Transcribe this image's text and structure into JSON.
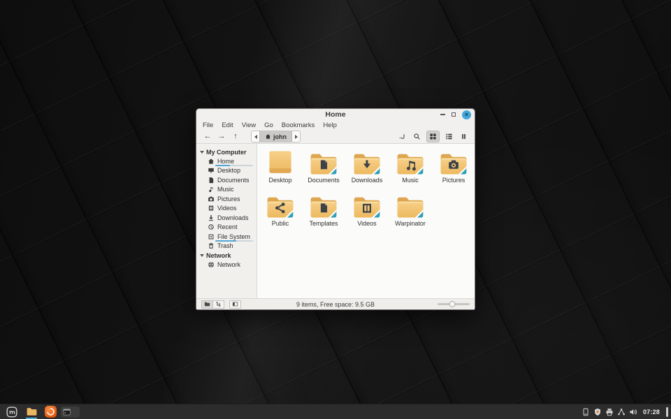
{
  "colors": {
    "accent": "#4da6d6",
    "close_button": "#45a7d9",
    "folder": "#f3c776",
    "folder_tab": "#dda64f",
    "emblem": "#3d4247",
    "ribbon": "#2f9fb7",
    "taskbar": "#2c2c2c"
  },
  "window": {
    "title": "Home",
    "controls": {
      "close": "×"
    },
    "menubar": {
      "items": [
        {
          "label": "File"
        },
        {
          "label": "Edit"
        },
        {
          "label": "View"
        },
        {
          "label": "Go"
        },
        {
          "label": "Bookmarks"
        },
        {
          "label": "Help"
        }
      ]
    },
    "toolbar": {
      "path_segment": "john",
      "nav": {
        "back": "←",
        "forward": "→",
        "up": "↑"
      }
    },
    "sidebar": {
      "sections": [
        {
          "label": "My Computer",
          "items": [
            {
              "label": "Home",
              "icon": "home",
              "selected": true,
              "usage": 0.38,
              "name": "sidebar-item-home"
            },
            {
              "label": "Desktop",
              "icon": "desktop",
              "name": "sidebar-item-desktop"
            },
            {
              "label": "Documents",
              "icon": "document",
              "name": "sidebar-item-documents"
            },
            {
              "label": "Music",
              "icon": "music",
              "name": "sidebar-item-music"
            },
            {
              "label": "Pictures",
              "icon": "camera",
              "name": "sidebar-item-pictures"
            },
            {
              "label": "Videos",
              "icon": "video",
              "name": "sidebar-item-videos"
            },
            {
              "label": "Downloads",
              "icon": "download",
              "name": "sidebar-item-downloads"
            },
            {
              "label": "Recent",
              "icon": "recent",
              "name": "sidebar-item-recent"
            },
            {
              "label": "File System",
              "icon": "filesystem",
              "usage": 0.55,
              "name": "sidebar-item-filesystem"
            },
            {
              "label": "Trash",
              "icon": "trash",
              "name": "sidebar-item-trash"
            }
          ]
        },
        {
          "label": "Network",
          "items": [
            {
              "label": "Network",
              "icon": "network",
              "name": "sidebar-item-network"
            }
          ]
        }
      ]
    },
    "files": [
      {
        "name": "Desktop",
        "icon": "desktop",
        "emblem": "none"
      },
      {
        "name": "Documents",
        "icon": "folder",
        "emblem": "document"
      },
      {
        "name": "Downloads",
        "icon": "folder",
        "emblem": "download"
      },
      {
        "name": "Music",
        "icon": "folder",
        "emblem": "music"
      },
      {
        "name": "Pictures",
        "icon": "folder",
        "emblem": "camera"
      },
      {
        "name": "Public",
        "icon": "folder",
        "emblem": "share"
      },
      {
        "name": "Templates",
        "icon": "folder",
        "emblem": "document"
      },
      {
        "name": "Videos",
        "icon": "folder",
        "emblem": "video"
      },
      {
        "name": "Warpinator",
        "icon": "folder",
        "emblem": "none"
      }
    ],
    "statusbar": {
      "text": "9 items, Free space: 9.5 GB",
      "zoom_level": 0.45
    }
  },
  "taskbar": {
    "clock": "07:28",
    "tray": [
      {
        "icon": "report",
        "name": "report-tray-icon"
      },
      {
        "icon": "shield",
        "name": "update-shield-tray-icon"
      },
      {
        "icon": "printer",
        "name": "printer-tray-icon"
      },
      {
        "icon": "network",
        "name": "network-tray-icon"
      },
      {
        "icon": "volume",
        "name": "volume-tray-icon"
      }
    ]
  }
}
